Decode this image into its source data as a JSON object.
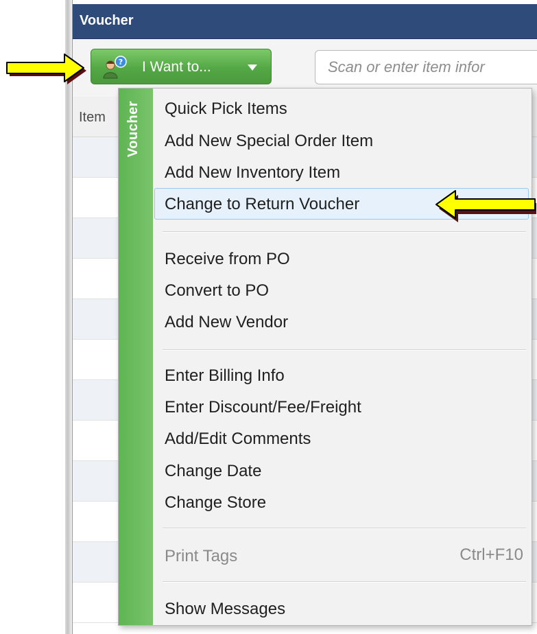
{
  "window": {
    "title": "Voucher"
  },
  "toolbar": {
    "i_want_label": "I Want to...",
    "search_placeholder": "Scan or enter item infor"
  },
  "grid": {
    "columns": [
      "Item"
    ]
  },
  "menu": {
    "side_label": "Voucher",
    "groups": [
      [
        {
          "label": "Quick Pick Items"
        },
        {
          "label": "Add New Special Order Item"
        },
        {
          "label": "Add New Inventory Item"
        },
        {
          "label": "Change to Return Voucher",
          "highlighted": true
        }
      ],
      [
        {
          "label": "Receive from PO"
        },
        {
          "label": "Convert to PO"
        },
        {
          "label": "Add New Vendor"
        }
      ],
      [
        {
          "label": "Enter Billing Info"
        },
        {
          "label": "Enter Discount/Fee/Freight"
        },
        {
          "label": "Add/Edit Comments"
        },
        {
          "label": "Change Date"
        },
        {
          "label": "Change Store"
        }
      ],
      [
        {
          "label": "Print Tags",
          "shortcut": "Ctrl+F10",
          "disabled": true
        }
      ],
      [
        {
          "label": "Show Messages"
        }
      ]
    ]
  },
  "icons": {
    "i_want_icon": "user-help-icon",
    "caret": "caret-down-icon",
    "annotation_arrows": [
      "arrow-right-icon",
      "arrow-left-icon"
    ]
  },
  "colors": {
    "titlebar": "#2f4b7a",
    "button_green": "#54a845",
    "menu_side": "#6cbd5e",
    "highlight": "#e6f1fb",
    "arrow_fill": "#ffff00"
  }
}
